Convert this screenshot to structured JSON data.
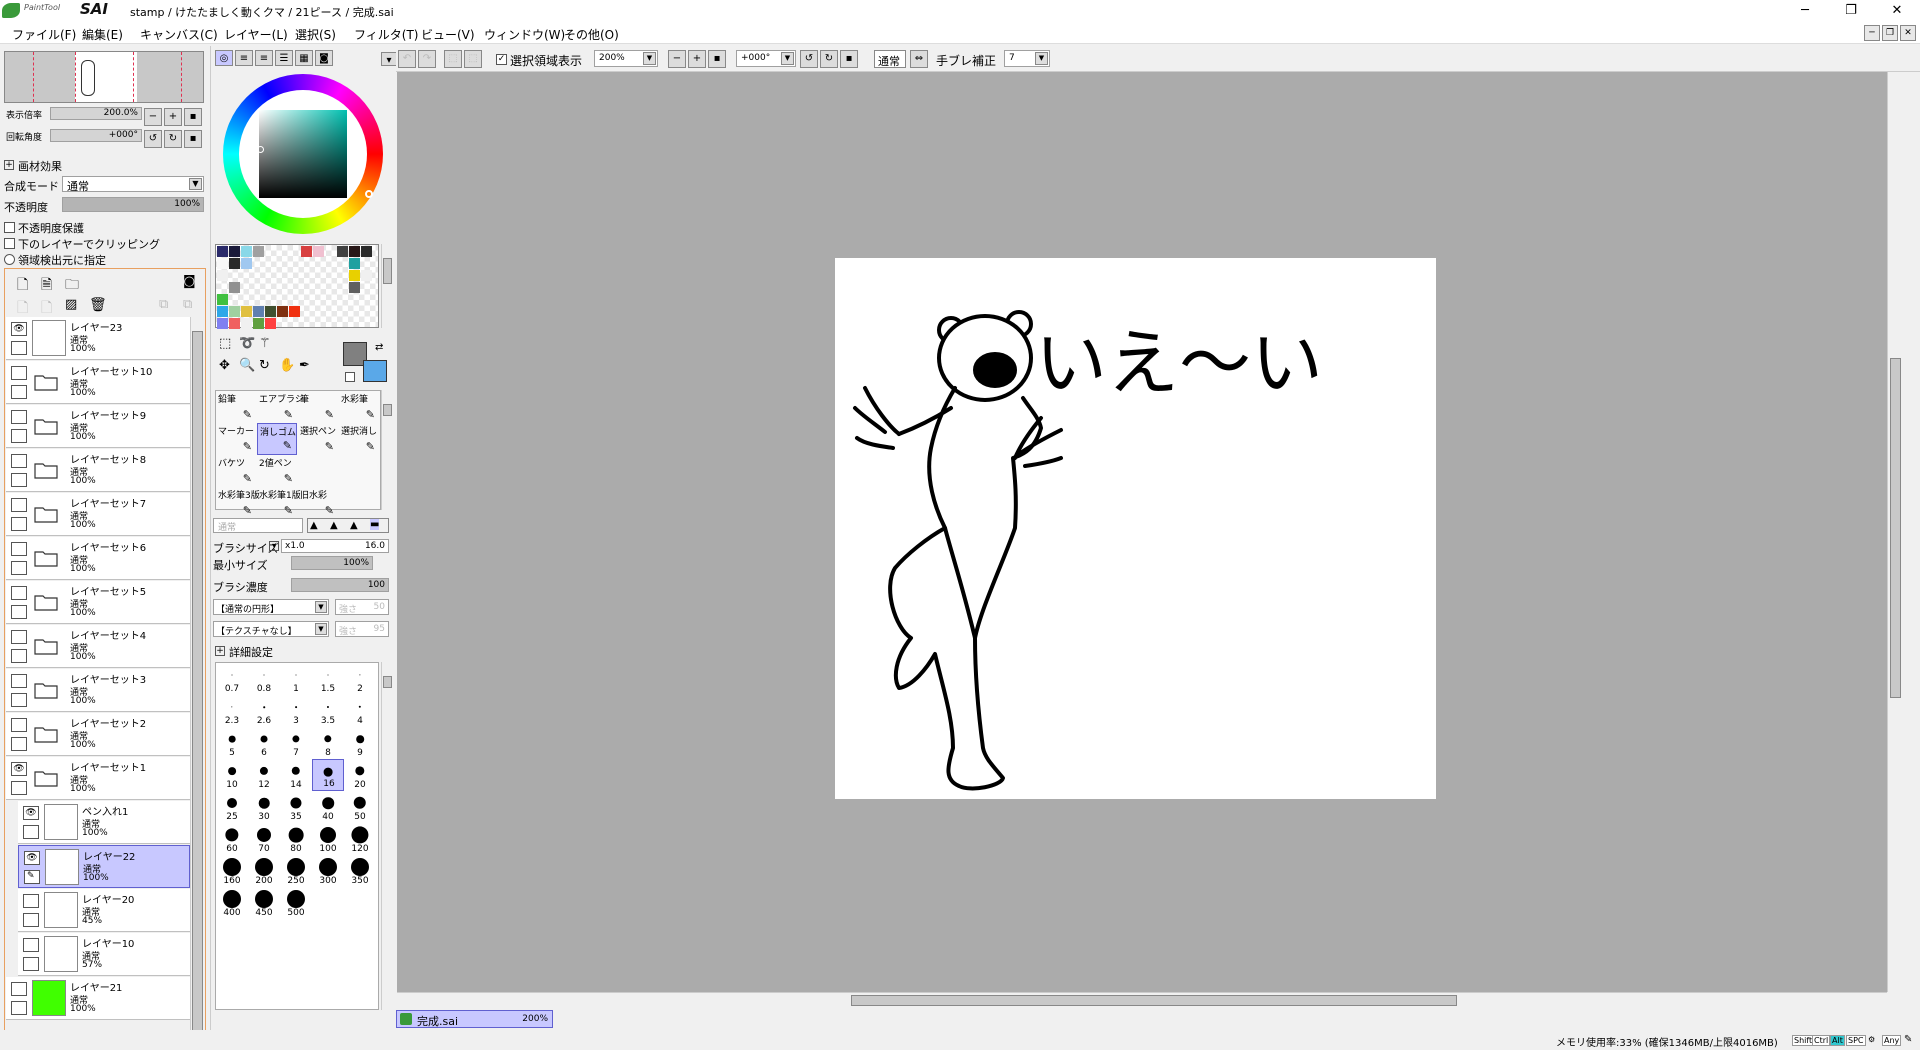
{
  "app": {
    "title": "stamp / けたたましく動くクマ / 21ピース / 完成.sai",
    "logo_small": "PaintTool",
    "logo_big": "SAI",
    "window_controls": [
      "─",
      "❐",
      "✕"
    ]
  },
  "menu": [
    "ファイル(F)",
    "編集(E)",
    "キャンバス(C)",
    "レイヤー(L)",
    "選択(S)",
    "フィルタ(T)",
    "ビュー(V)",
    "ウィンドウ(W)",
    "その他(O)"
  ],
  "navigator": {
    "zoom_label": "表示倍率",
    "zoom_value": "200.0%",
    "rotate_label": "回転角度",
    "rotate_value": "+000°"
  },
  "layer_props": {
    "effect_label": "画材効果",
    "blend_label": "合成モード",
    "blend_value": "通常",
    "opacity_label": "不透明度",
    "opacity_value": "100%",
    "opacity_fraction": 1.0,
    "preserve_opacity": "不透明度保護",
    "clip_below": "下のレイヤーでクリッピング",
    "selection_source": "領域検出元に指定"
  },
  "layers": [
    {
      "name": "レイヤー23",
      "mode": "通常",
      "opacity": "100%",
      "type": "layer",
      "visible": true
    },
    {
      "name": "レイヤーセット10",
      "mode": "通常",
      "opacity": "100%",
      "type": "folder",
      "visible": false
    },
    {
      "name": "レイヤーセット9",
      "mode": "通常",
      "opacity": "100%",
      "type": "folder",
      "visible": false
    },
    {
      "name": "レイヤーセット8",
      "mode": "通常",
      "opacity": "100%",
      "type": "folder",
      "visible": false
    },
    {
      "name": "レイヤーセット7",
      "mode": "通常",
      "opacity": "100%",
      "type": "folder",
      "visible": false
    },
    {
      "name": "レイヤーセット6",
      "mode": "通常",
      "opacity": "100%",
      "type": "folder",
      "visible": false
    },
    {
      "name": "レイヤーセット5",
      "mode": "通常",
      "opacity": "100%",
      "type": "folder",
      "visible": false
    },
    {
      "name": "レイヤーセット4",
      "mode": "通常",
      "opacity": "100%",
      "type": "folder",
      "visible": false
    },
    {
      "name": "レイヤーセット3",
      "mode": "通常",
      "opacity": "100%",
      "type": "folder",
      "visible": false
    },
    {
      "name": "レイヤーセット2",
      "mode": "通常",
      "opacity": "100%",
      "type": "folder",
      "visible": false
    },
    {
      "name": "レイヤーセット1",
      "mode": "通常",
      "opacity": "100%",
      "type": "folder-open",
      "visible": true
    },
    {
      "name": "ペン入れ1",
      "mode": "通常",
      "opacity": "100%",
      "type": "pen",
      "visible": true,
      "indent": true
    },
    {
      "name": "レイヤー22",
      "mode": "通常",
      "opacity": "100%",
      "type": "layer",
      "visible": true,
      "indent": true,
      "selected": true
    },
    {
      "name": "レイヤー20",
      "mode": "通常",
      "opacity": "45%",
      "type": "layer",
      "visible": false,
      "indent": true
    },
    {
      "name": "レイヤー10",
      "mode": "通常",
      "opacity": "57%",
      "type": "layer",
      "visible": false,
      "indent": true
    },
    {
      "name": "レイヤー21",
      "mode": "通常",
      "opacity": "100%",
      "type": "green",
      "visible": false
    }
  ],
  "toolbar": {
    "show_selection": "選択領域表示",
    "zoom": "200%",
    "rotate": "+000°",
    "mode": "通常",
    "stabilizer_label": "手ブレ補正",
    "stabilizer_value": "7"
  },
  "tools": [
    {
      "label": "鉛筆"
    },
    {
      "label": "エアブラシ"
    },
    {
      "label": "筆"
    },
    {
      "label": "水彩筆"
    },
    {
      "label": "マーカー"
    },
    {
      "label": "消しゴム",
      "selected": true
    },
    {
      "label": "選択ペン"
    },
    {
      "label": "選択消し"
    },
    {
      "label": "バケツ"
    },
    {
      "label": "2値ペン"
    },
    {
      "label": ""
    },
    {
      "label": ""
    },
    {
      "label": "水彩筆3版"
    },
    {
      "label": "水彩筆1版"
    },
    {
      "label": "旧水彩"
    },
    {
      "label": ""
    }
  ],
  "brush": {
    "mode": "通常",
    "size_label": "ブラシサイズ",
    "size_mult": "x1.0",
    "size_value": "16.0",
    "min_size_label": "最小サイズ",
    "min_size_value": "100%",
    "density_label": "ブラシ濃度",
    "density_value": "100",
    "shape": "【通常の円形】",
    "texture": "【テクスチャなし】",
    "strength1": "強さ",
    "strength1_value": "50",
    "strength2": "強さ",
    "strength2_value": "95",
    "advanced": "詳細設定"
  },
  "brush_sizes": [
    "0.7",
    "0.8",
    "1",
    "1.5",
    "2",
    "2.3",
    "2.6",
    "3",
    "3.5",
    "4",
    "5",
    "6",
    "7",
    "8",
    "9",
    "10",
    "12",
    "14",
    "16",
    "20",
    "25",
    "30",
    "35",
    "40",
    "50",
    "60",
    "70",
    "80",
    "100",
    "120",
    "160",
    "200",
    "250",
    "300",
    "350",
    "400",
    "450",
    "500"
  ],
  "selected_brush_size": "16",
  "swatches": [
    "#2a2a6a",
    "#1a1a3a",
    "#8ad8e8",
    "#a0a0a0",
    "#d84040",
    "#f0c0d0",
    "#404040",
    "#281818",
    "#2a2a2a",
    "#f8f8f8",
    "#2a2a2a",
    "#a0c8f0",
    "#20a0a0",
    "#f0f0f0",
    "#ff8000",
    "#e8d000",
    "#f0f0f0",
    "#909090",
    "#40c040",
    "#606060",
    "#2ea8e8",
    "#a0d0a0",
    "#e0c040",
    "#6080b0",
    "#405030",
    "#803010",
    "#f03010",
    "#8080f0",
    "#f06060",
    "#f0f0f0",
    "#60a040",
    "#ff4040"
  ],
  "colors": {
    "primary": "#808080",
    "secondary": "#5aa8e8",
    "accent_select": "#c8c8ff",
    "canvas_bg": "#ababab"
  },
  "doc_tab": {
    "name": "完成.sai",
    "zoom": "200%"
  },
  "status": {
    "memory": "メモリ使用率:33% (確保1346MB/上限4016MB)",
    "keys": [
      "Shift",
      "Ctrl",
      "Alt",
      "SPC",
      "Any"
    ]
  },
  "artwork": {
    "text": "いえ〜い"
  }
}
